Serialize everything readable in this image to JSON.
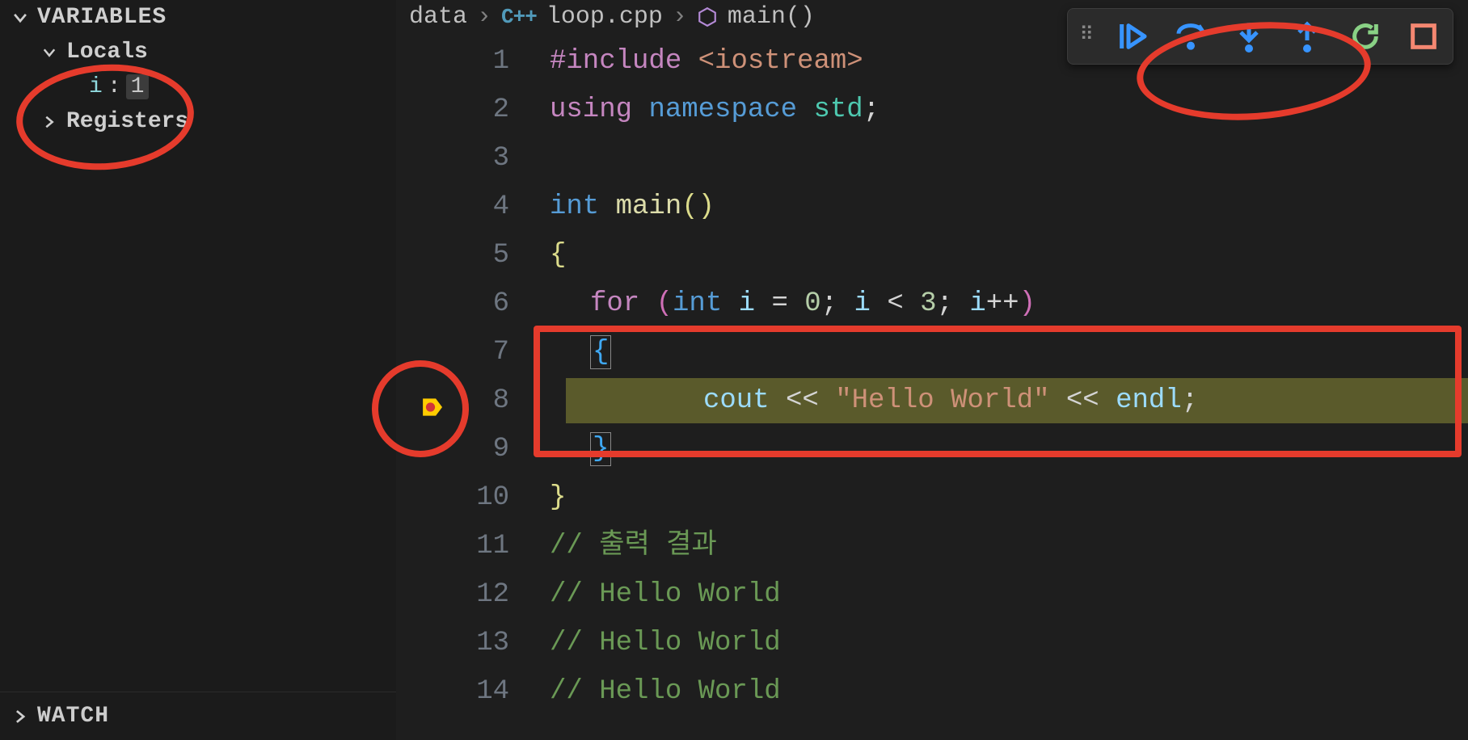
{
  "sidebar": {
    "title": "VARIABLES",
    "locals_label": "Locals",
    "registers_label": "Registers",
    "watch_label": "WATCH",
    "variable": {
      "name": "i",
      "value": "1"
    }
  },
  "breadcrumb": {
    "folder": "data",
    "lang_badge": "C++",
    "file": "loop.cpp",
    "symbol": "main()"
  },
  "debug_toolbar": {
    "continue": "Continue",
    "step_over": "Step Over",
    "step_into": "Step Into",
    "step_out": "Step Out",
    "restart": "Restart",
    "stop": "Stop",
    "colors": {
      "blue": "#3794ff",
      "green": "#89d185",
      "red": "#f48771",
      "stop": "#d16969"
    }
  },
  "editor": {
    "current_line": 8,
    "lines": {
      "1": {
        "pp": "#include",
        "inc": "<iostream>"
      },
      "2": {
        "kw": "using",
        "kw2": "namespace",
        "ns": "std",
        "semi": ";"
      },
      "3": {
        "blank": ""
      },
      "4": {
        "type": "int",
        "fn": "main",
        "paren": "()"
      },
      "5": {
        "brace": "{"
      },
      "6": {
        "for": "for",
        "po": "(",
        "type": "int",
        "id": "i",
        "eq": "=",
        "n0": "0",
        "semi1": ";",
        "id2": "i",
        "lt": "<",
        "n3": "3",
        "semi2": ";",
        "id3": "i",
        "pp": "++",
        "pc": ")"
      },
      "7": {
        "brace": "{"
      },
      "8": {
        "cout": "cout",
        "op1": "<<",
        "str": "\"Hello World\"",
        "op2": "<<",
        "endl": "endl",
        "semi": ";"
      },
      "9": {
        "brace": "}"
      },
      "10": {
        "brace": "}"
      },
      "11": {
        "cmt": "// 출력 결과"
      },
      "12": {
        "cmt": "// Hello World"
      },
      "13": {
        "cmt": "// Hello World"
      },
      "14": {
        "cmt": "// Hello World"
      }
    }
  }
}
